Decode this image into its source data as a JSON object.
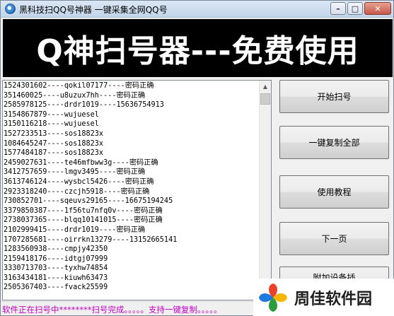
{
  "window": {
    "title": "黑科技扫QQ号神器  一键采集全网QQ号",
    "controls": {
      "minimize": "–",
      "maximize": "□",
      "close": "✕"
    }
  },
  "banner": {
    "text": "Q神扫号器---免费使用"
  },
  "results": [
    "1524301602----qokil07177----密码正确",
    "351460025----u8uzux7hh----密码正确",
    "2585978125----drdr1019----15636754913",
    "3154867879----wujuesel",
    "3150116218----wujuesel",
    "1527233513----sos18823x",
    "1084645247----sos18823x",
    "1577484187----sos18823x",
    "2459027631----te46mfbww3g----密码正确",
    "3412757659----lmgv3495----密码正确",
    "3613746124----wysbcl5426----密码正确",
    "2923318240----czcjh5918----密码正确",
    "730852701----sqeuvs29165----16675194245",
    "3379850387----1f56tu7nfq0v----密码正确",
    "2738037365----blqq10141015----密码正确",
    "2102999415----drdr1019----密码正确",
    "1707285681----oirrkn13279----13152665141",
    "1283560938----cmpjy42350",
    "2159418176----idtgj07999",
    "3330713703----tyxhw74854",
    "3163434181----kiuwh63473",
    "2505367403----fvack25599"
  ],
  "scrollbar": {
    "up_arrow": "▲",
    "down_arrow": "▼"
  },
  "buttons": {
    "start": "开始扫号",
    "copy_all": "一键复制全部",
    "tutorial": "使用教程",
    "next_page": "下一页",
    "partial": "附加设备插"
  },
  "status": {
    "text": "软件正在扫号中********扫号完成。。。。。支持一键复制。。。。。"
  },
  "watermark": {
    "text": "周佳软件园",
    "colors": [
      "#e8412c",
      "#f7b500",
      "#2d9c3c",
      "#1f7ae0"
    ]
  }
}
